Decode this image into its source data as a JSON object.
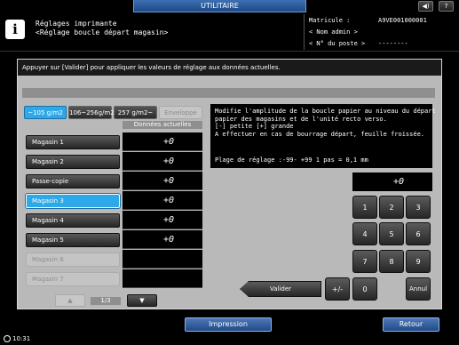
{
  "topbar": {
    "tab_title": "UTILITAIRE",
    "volume_icon": "speaker-icon",
    "help_label": "?"
  },
  "header": {
    "title_line1": "Réglages imprimante",
    "title_line2": "<Réglage boucle départ magasin>",
    "serial_label": "Matricule :",
    "serial_value": "A9VE001000001",
    "admin_label": "< Nom admin >",
    "post_label": "< N° du poste >",
    "post_value": "--------"
  },
  "panel": {
    "instruction": "Appuyer sur [Valider] pour appliquer les valeurs de réglage aux données actuelles.",
    "paper_tabs": [
      {
        "label": "~105 g/m2",
        "state": "active"
      },
      {
        "label": "106~256g/m2",
        "state": "normal"
      },
      {
        "label": "257 g/m2~",
        "state": "normal"
      },
      {
        "label": "Enveloppe",
        "state": "disabled"
      }
    ],
    "column_header": "Données actuelles",
    "trays": [
      {
        "label": "Magasin 1",
        "value": "+0"
      },
      {
        "label": "Magasin 2",
        "value": "+0"
      },
      {
        "label": "Passe-copie",
        "value": "+0"
      },
      {
        "label": "Magasin 3",
        "value": "+0"
      },
      {
        "label": "Magasin 4",
        "value": "+0"
      },
      {
        "label": "Magasin 5",
        "value": "+0"
      },
      {
        "label": "Magasin 6",
        "value": ""
      },
      {
        "label": "Magasin 7",
        "value": ""
      }
    ],
    "page_indicator": "1/3",
    "up_arrow": "▲",
    "down_arrow": "▼",
    "description": [
      "Modifie l'amplitude de la boucle papier au niveau du départ",
      "papier des magasins et de l'unité recto verso.",
      "[-] petite [+] grande",
      "A effectuer en cas de bourrage départ, feuille froissée."
    ],
    "range_text": "Plage de réglage :-99- +99 1 pas = 0,1 mm",
    "entry_value": "+0",
    "keypad": [
      "1",
      "2",
      "3",
      "4",
      "5",
      "6",
      "7",
      "8",
      "9",
      "0",
      "Annul"
    ],
    "plusminus_label": "+/-",
    "validate_label": "Valider"
  },
  "footer": {
    "print_label": "Impression",
    "back_label": "Retour",
    "time": "10:31"
  },
  "colors": {
    "accent": "#2da9ea",
    "header_blue": "#1e4a86",
    "panel": "#b9b9b9"
  }
}
